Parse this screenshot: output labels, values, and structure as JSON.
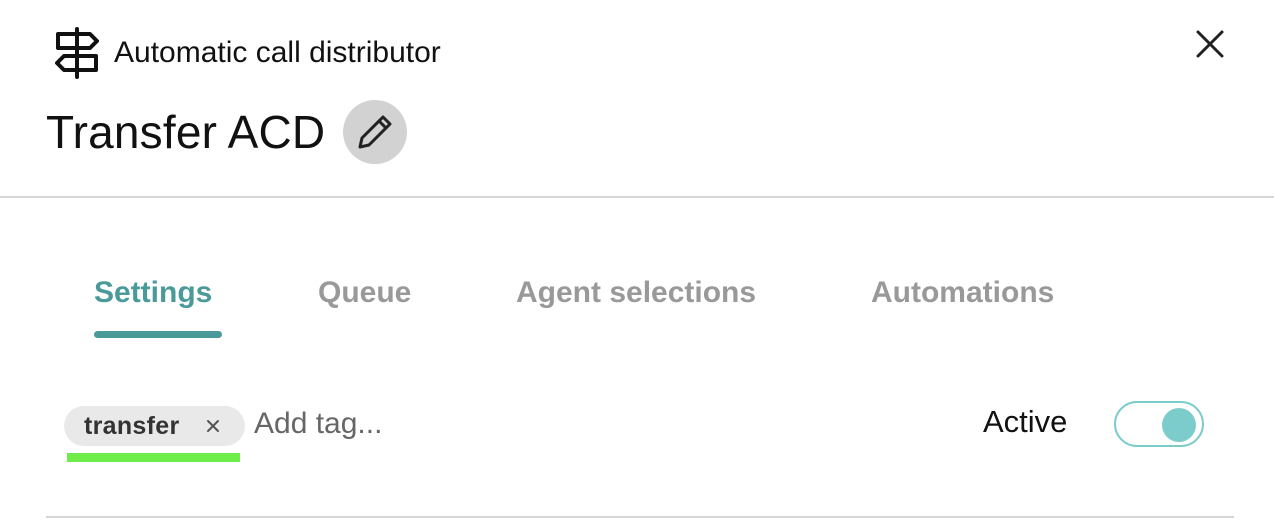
{
  "header": {
    "type_label": "Automatic call distributor",
    "type_icon": "signpost-icon",
    "close_icon": "close-icon"
  },
  "title": {
    "text": "Transfer ACD",
    "edit_icon": "pencil-icon"
  },
  "tabs": [
    {
      "label": "Settings",
      "active": true
    },
    {
      "label": "Queue",
      "active": false
    },
    {
      "label": "Agent selections",
      "active": false
    },
    {
      "label": "Automations",
      "active": false
    }
  ],
  "tags": {
    "items": [
      {
        "label": "transfer",
        "remove_icon": "close-icon"
      }
    ],
    "input_placeholder": "Add tag..."
  },
  "status": {
    "label": "Active",
    "enabled": true
  },
  "colors": {
    "accent": "#4b9a9a",
    "toggle": "#7dcccc",
    "highlight": "#6eec4a",
    "inactive_tab": "#999999"
  }
}
